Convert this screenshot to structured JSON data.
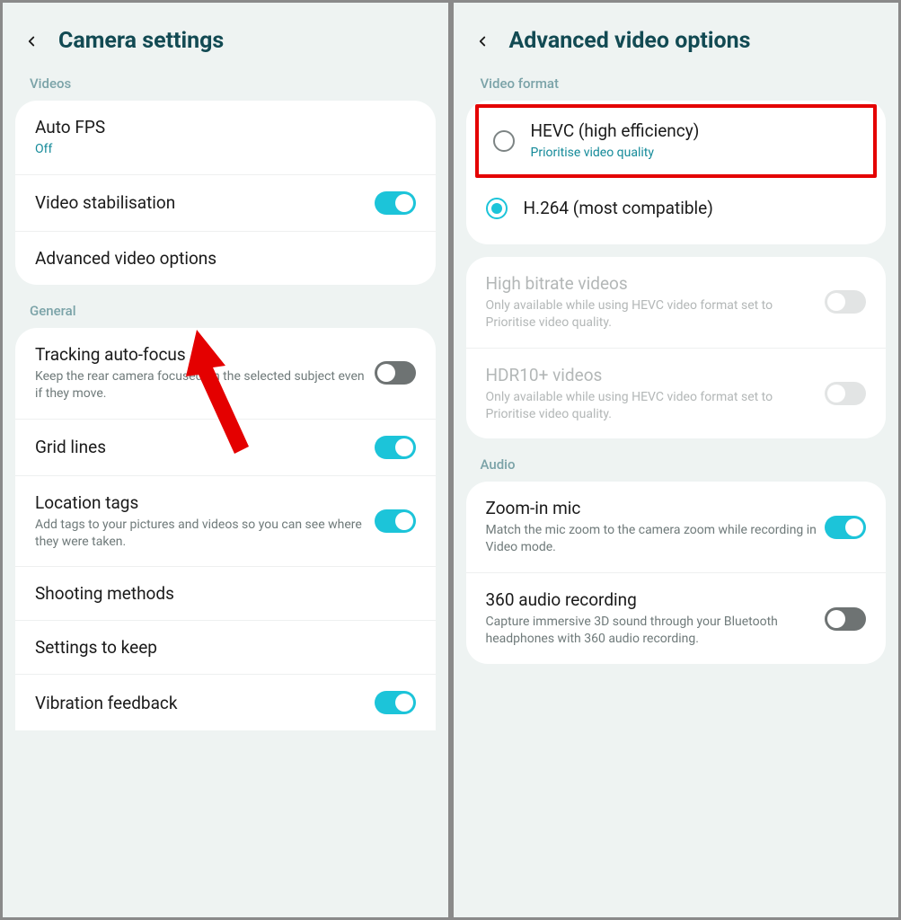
{
  "left": {
    "title": "Camera settings",
    "sections": {
      "videos": {
        "label": "Videos",
        "autofps": {
          "title": "Auto FPS",
          "sub": "Off"
        },
        "stabilisation": {
          "title": "Video stabilisation"
        },
        "advanced": {
          "title": "Advanced video options"
        }
      },
      "general": {
        "label": "General",
        "tracking": {
          "title": "Tracking auto-focus",
          "sub": "Keep the rear camera focused on the selected subject even if they move."
        },
        "grid": {
          "title": "Grid lines"
        },
        "location": {
          "title": "Location tags",
          "sub": "Add tags to your pictures and videos so you can see where they were taken."
        },
        "shooting": {
          "title": "Shooting methods"
        },
        "keep": {
          "title": "Settings to keep"
        },
        "vibration": {
          "title": "Vibration feedback"
        }
      }
    }
  },
  "right": {
    "title": "Advanced video options",
    "sections": {
      "format": {
        "label": "Video format",
        "hevc": {
          "title": "HEVC (high efficiency)",
          "sub": "Prioritise video quality"
        },
        "h264": {
          "title": "H.264 (most compatible)"
        }
      },
      "bitrate": {
        "title": "High bitrate videos",
        "sub": "Only available while using HEVC video format set to Prioritise video quality."
      },
      "hdr10": {
        "title": "HDR10+ videos",
        "sub": "Only available while using HEVC video format set to Prioritise video quality."
      },
      "audio": {
        "label": "Audio",
        "zoom": {
          "title": "Zoom-in mic",
          "sub": "Match the mic zoom to the camera zoom while recording in Video mode."
        },
        "audio360": {
          "title": "360 audio recording",
          "sub": "Capture immersive 3D sound through your Bluetooth headphones with 360 audio recording."
        }
      }
    }
  }
}
